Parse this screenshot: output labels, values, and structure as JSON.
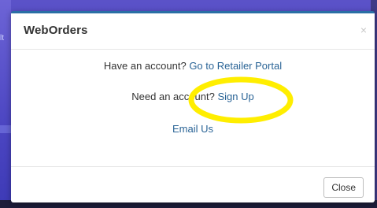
{
  "background": {
    "left_fragment": "lt"
  },
  "modal": {
    "title": "WebOrders",
    "close_icon": "×",
    "account_prompt": "Have an account?",
    "retailer_link": "Go to Retailer Portal",
    "signup_prompt": "Need an account?",
    "signup_link": "Sign Up",
    "email_link": "Email Us",
    "close_button": "Close"
  },
  "colors": {
    "accent": "#2a6fa5",
    "link": "#2a6496",
    "annotation": "#ffee00"
  },
  "icons": [
    "close-icon"
  ]
}
